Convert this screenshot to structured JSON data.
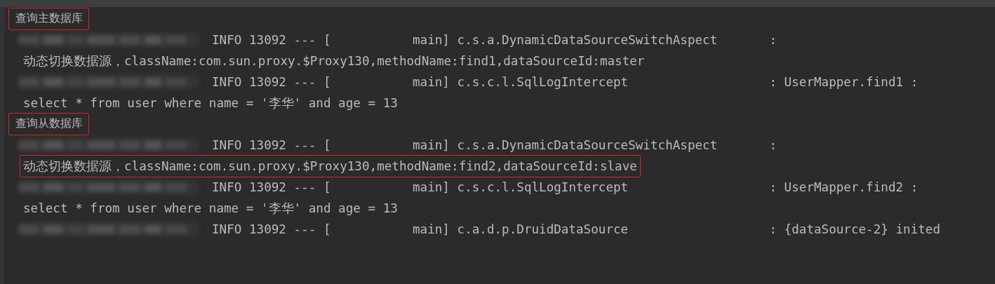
{
  "console": {
    "lines": [
      {
        "kind": "note",
        "text": "查询主数据库"
      },
      {
        "kind": "log",
        "head": "INFO 13092 --- [           main]",
        "logger": "c.s.a.DynamicDataSourceSwitchAspect",
        "tail": ":"
      },
      {
        "kind": "message",
        "text": "动态切换数据源，className:com.sun.proxy.$Proxy130,methodName:find1,dataSourceId:master",
        "highlighted": false
      },
      {
        "kind": "log",
        "head": "INFO 13092 --- [           main]",
        "logger": "c.s.c.l.SqlLogIntercept",
        "tail": ": UserMapper.find1 :"
      },
      {
        "kind": "message",
        "text": "select * from user where name = '李华' and age = 13",
        "highlighted": false
      },
      {
        "kind": "note",
        "text": "查询从数据库"
      },
      {
        "kind": "log",
        "head": "INFO 13092 --- [           main]",
        "logger": "c.s.a.DynamicDataSourceSwitchAspect",
        "tail": ":"
      },
      {
        "kind": "message",
        "text": "动态切换数据源，className:com.sun.proxy.$Proxy130,methodName:find2,dataSourceId:slave",
        "highlighted": true
      },
      {
        "kind": "log",
        "head": "INFO 13092 --- [           main]",
        "logger": "c.s.c.l.SqlLogIntercept",
        "tail": ": UserMapper.find2 :"
      },
      {
        "kind": "message",
        "text": "select * from user where name = '李华' and age = 13",
        "highlighted": false
      },
      {
        "kind": "log",
        "head": "INFO 13092 --- [           main]",
        "logger": "c.a.d.p.DruidDataSource",
        "tail": ": {dataSource-2} inited"
      }
    ]
  }
}
